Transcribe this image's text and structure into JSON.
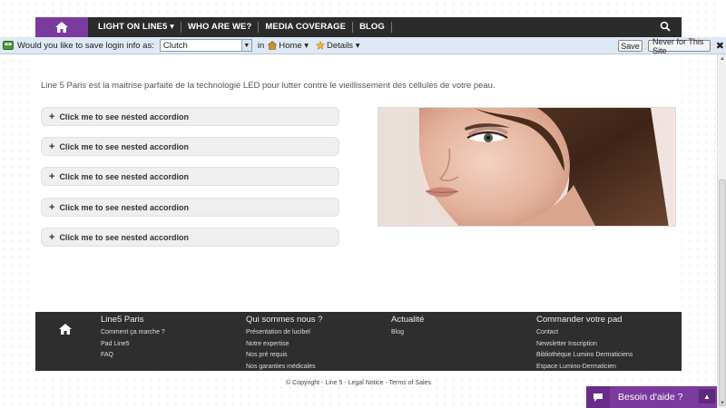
{
  "nav": {
    "items": [
      "LIGHT ON LINE5 ▾",
      "WHO ARE WE?",
      "MEDIA COVERAGE",
      "BLOG"
    ]
  },
  "savebar": {
    "prompt": "Would you like to save login info as:",
    "selected": "Clutch",
    "in_label": "in",
    "home_menu": "Home ▾",
    "details_menu": "Details ▾",
    "save_label": "Save",
    "never_label": "Never for This Site",
    "close_glyph": "✖"
  },
  "main": {
    "intro": "Line 5 Paris est la maitrise parfaite de la technologie LED pour lutter contre le vieillissement des cellules de votre peau.",
    "accordions": [
      "Click me to see nested accordion",
      "Click me to see nested accordion",
      "Click me to see nested accordion",
      "Click me to see nested accordion",
      "Click me to see nested accordion"
    ]
  },
  "footer": {
    "columns": [
      {
        "heading": "Line5 Paris",
        "links": [
          "Comment ça marche ?",
          "Pad Line5",
          "FAQ"
        ]
      },
      {
        "heading": "Qui sommes nous ?",
        "links": [
          "Présentation de lucibel",
          "Notre expertise",
          "Nos pré requis",
          "Nos garanties médicales"
        ]
      },
      {
        "heading": "Actualité",
        "links": [
          "Blog"
        ]
      },
      {
        "heading": "Commander votre pad",
        "links": [
          "Contact",
          "Newsletter Inscription",
          "Bibliothèque Lumino Dermaticiens",
          "Espace Lumino-Dermaticien"
        ]
      }
    ],
    "copyright": "© Copyright - Line 5 - Legal Notice - Terms of Sales"
  },
  "chat": {
    "label": "Besoin d'aide ?"
  },
  "colors": {
    "brand_purple": "#7b3a9e",
    "nav_dark": "#2b2b2b",
    "footer_dark": "#2e2e2e",
    "savebar_bg": "#dfe9f5"
  },
  "icons": [
    "home-icon",
    "search-icon",
    "savebar-logo-icon",
    "dropdown-arrow-icon",
    "home-menu-icon",
    "details-menu-icon",
    "close-icon",
    "plus-icon",
    "chat-bubble-icon",
    "chevron-up-icon"
  ]
}
